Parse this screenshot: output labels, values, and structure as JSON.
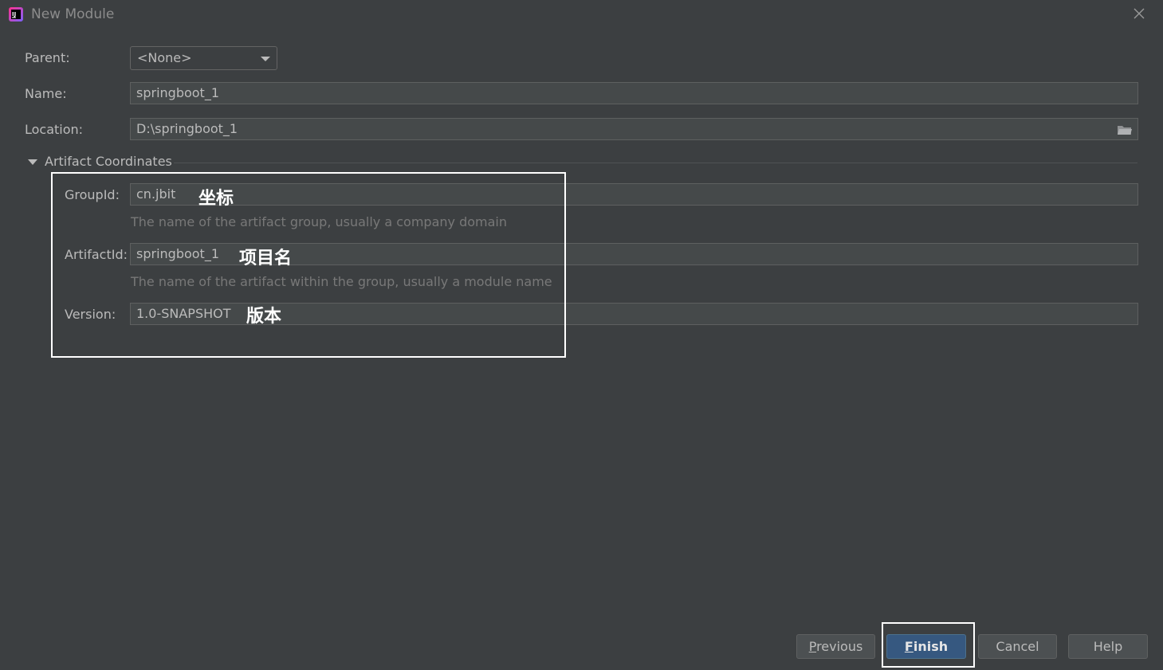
{
  "window": {
    "title": "New Module"
  },
  "form": {
    "parent": {
      "label": "Parent:",
      "value": "<None>"
    },
    "name": {
      "label": "Name:",
      "value": "springboot_1"
    },
    "location": {
      "label": "Location:",
      "value": "D:\\springboot_1"
    }
  },
  "artifact": {
    "section_title": "Artifact Coordinates",
    "group_id": {
      "label": "GroupId:",
      "value": "cn.jbit",
      "hint": "The name of the artifact group, usually a company domain",
      "annotation": "坐标"
    },
    "artifact_id": {
      "label": "ArtifactId:",
      "value": "springboot_1",
      "hint": "The name of the artifact within the group, usually a module name",
      "annotation": "项目名"
    },
    "version": {
      "label": "Version:",
      "value": "1.0-SNAPSHOT",
      "annotation": "版本"
    }
  },
  "buttons": {
    "previous": {
      "mnemonic": "P",
      "rest": "revious"
    },
    "finish": {
      "mnemonic": "F",
      "rest": "inish"
    },
    "cancel": "Cancel",
    "help": "Help"
  },
  "colors": {
    "background": "#3c3f41",
    "field": "#45494a",
    "primary_button": "#365880",
    "highlight_box": "#ffffff"
  }
}
